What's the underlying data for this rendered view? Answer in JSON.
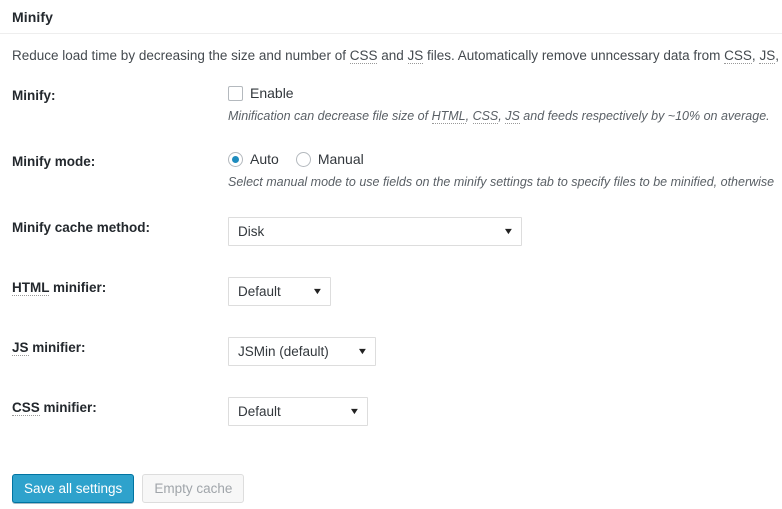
{
  "panel": {
    "title": "Minify",
    "intro": "Reduce load time by decreasing the size and number of CSS and JS files. Automatically remove unncessary data from CSS, JS, feed, p"
  },
  "fields": {
    "minify": {
      "label": "Minify:",
      "checkbox_label": "Enable",
      "checked": false,
      "description": "Minification can decrease file size of HTML, CSS, JS and feeds respectively by ~10% on average."
    },
    "minify_mode": {
      "label": "Minify mode:",
      "options": [
        "Auto",
        "Manual"
      ],
      "selected": "Auto",
      "description": "Select manual mode to use fields on the minify settings tab to specify files to be minified, otherwise"
    },
    "minify_cache_method": {
      "label": "Minify cache method:",
      "value": "Disk"
    },
    "html_minifier": {
      "label": "HTML minifier:",
      "value": "Default"
    },
    "js_minifier": {
      "label": "JS minifier:",
      "value": "JSMin (default)"
    },
    "css_minifier": {
      "label": "CSS minifier:",
      "value": "Default"
    }
  },
  "buttons": {
    "save": "Save all settings",
    "empty_cache": "Empty cache"
  },
  "colors": {
    "primary": "#2ea2cc",
    "primary_border": "#0074a2",
    "radio_dot": "#1e8cbe",
    "text": "#32373c",
    "disabled_text": "#a0a5aa"
  }
}
